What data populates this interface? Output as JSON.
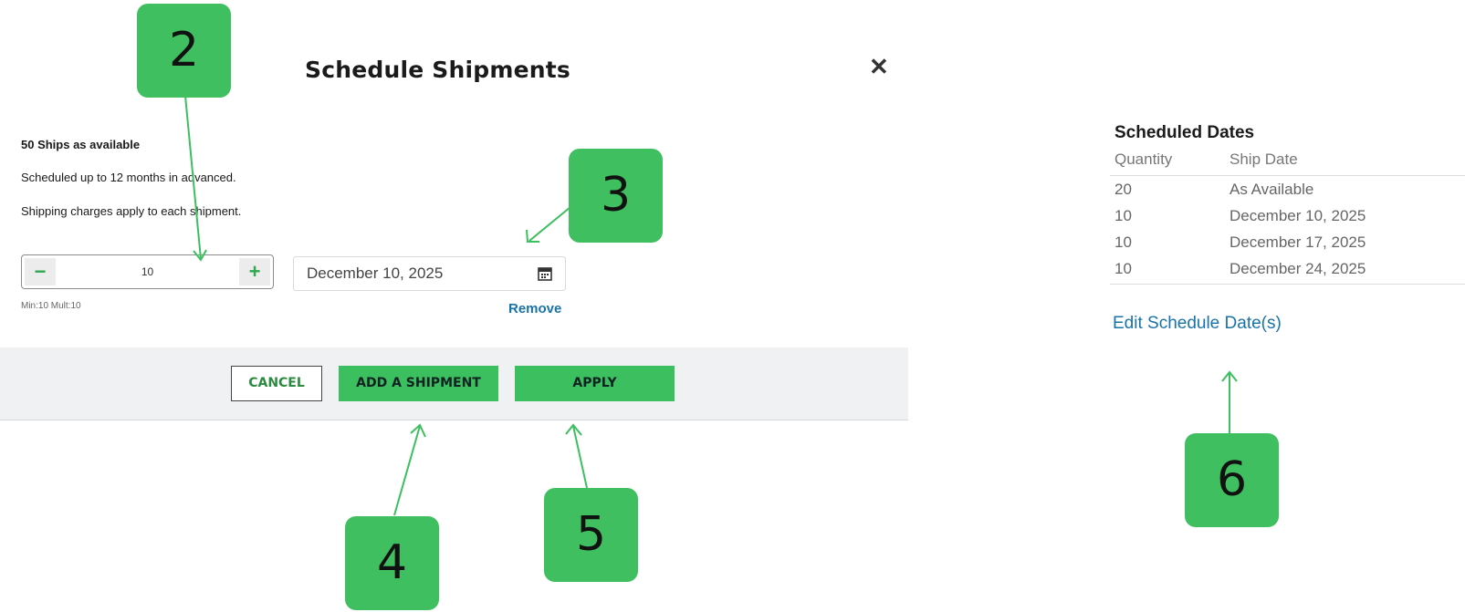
{
  "modal": {
    "title": "Schedule Shipments",
    "close_icon": "close-icon",
    "info_bold": "50 Ships as available",
    "info_line1": "Scheduled up to 12 months in advanced.",
    "info_line2": "Shipping charges apply to each shipment.",
    "stepper": {
      "minus": "−",
      "value": "10",
      "plus": "+"
    },
    "date_value": "December 10, 2025",
    "calendar_icon": "calendar-icon",
    "minmult": "Min:10  Mult:10",
    "remove_label": "Remove",
    "buttons": {
      "cancel": "CANCEL",
      "add": "ADD A SHIPMENT",
      "apply": "APPLY"
    }
  },
  "callouts": [
    "2",
    "3",
    "4",
    "5",
    "6"
  ],
  "scheduled": {
    "title": "Scheduled Dates",
    "headers": [
      "Quantity",
      "Ship Date"
    ],
    "rows": [
      [
        "20",
        "As Available"
      ],
      [
        "10",
        "December 10, 2025"
      ],
      [
        "10",
        "December 17, 2025"
      ],
      [
        "10",
        "December 24, 2025"
      ]
    ],
    "edit_label": "Edit Schedule Date(s)"
  },
  "colors": {
    "accent": "#3cbf5e",
    "callout": "#3fbf5f",
    "link": "#1a73a8",
    "footer": "#f0f1f2"
  }
}
